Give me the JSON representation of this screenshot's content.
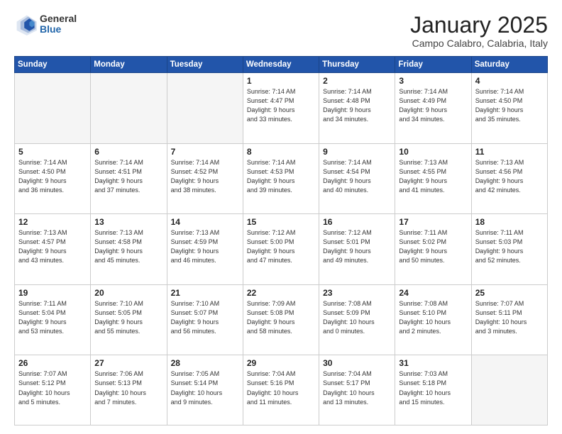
{
  "logo": {
    "general": "General",
    "blue": "Blue"
  },
  "header": {
    "month": "January 2025",
    "location": "Campo Calabro, Calabria, Italy"
  },
  "weekdays": [
    "Sunday",
    "Monday",
    "Tuesday",
    "Wednesday",
    "Thursday",
    "Friday",
    "Saturday"
  ],
  "weeks": [
    [
      {
        "day": "",
        "info": ""
      },
      {
        "day": "",
        "info": ""
      },
      {
        "day": "",
        "info": ""
      },
      {
        "day": "1",
        "info": "Sunrise: 7:14 AM\nSunset: 4:47 PM\nDaylight: 9 hours\nand 33 minutes."
      },
      {
        "day": "2",
        "info": "Sunrise: 7:14 AM\nSunset: 4:48 PM\nDaylight: 9 hours\nand 34 minutes."
      },
      {
        "day": "3",
        "info": "Sunrise: 7:14 AM\nSunset: 4:49 PM\nDaylight: 9 hours\nand 34 minutes."
      },
      {
        "day": "4",
        "info": "Sunrise: 7:14 AM\nSunset: 4:50 PM\nDaylight: 9 hours\nand 35 minutes."
      }
    ],
    [
      {
        "day": "5",
        "info": "Sunrise: 7:14 AM\nSunset: 4:50 PM\nDaylight: 9 hours\nand 36 minutes."
      },
      {
        "day": "6",
        "info": "Sunrise: 7:14 AM\nSunset: 4:51 PM\nDaylight: 9 hours\nand 37 minutes."
      },
      {
        "day": "7",
        "info": "Sunrise: 7:14 AM\nSunset: 4:52 PM\nDaylight: 9 hours\nand 38 minutes."
      },
      {
        "day": "8",
        "info": "Sunrise: 7:14 AM\nSunset: 4:53 PM\nDaylight: 9 hours\nand 39 minutes."
      },
      {
        "day": "9",
        "info": "Sunrise: 7:14 AM\nSunset: 4:54 PM\nDaylight: 9 hours\nand 40 minutes."
      },
      {
        "day": "10",
        "info": "Sunrise: 7:13 AM\nSunset: 4:55 PM\nDaylight: 9 hours\nand 41 minutes."
      },
      {
        "day": "11",
        "info": "Sunrise: 7:13 AM\nSunset: 4:56 PM\nDaylight: 9 hours\nand 42 minutes."
      }
    ],
    [
      {
        "day": "12",
        "info": "Sunrise: 7:13 AM\nSunset: 4:57 PM\nDaylight: 9 hours\nand 43 minutes."
      },
      {
        "day": "13",
        "info": "Sunrise: 7:13 AM\nSunset: 4:58 PM\nDaylight: 9 hours\nand 45 minutes."
      },
      {
        "day": "14",
        "info": "Sunrise: 7:13 AM\nSunset: 4:59 PM\nDaylight: 9 hours\nand 46 minutes."
      },
      {
        "day": "15",
        "info": "Sunrise: 7:12 AM\nSunset: 5:00 PM\nDaylight: 9 hours\nand 47 minutes."
      },
      {
        "day": "16",
        "info": "Sunrise: 7:12 AM\nSunset: 5:01 PM\nDaylight: 9 hours\nand 49 minutes."
      },
      {
        "day": "17",
        "info": "Sunrise: 7:11 AM\nSunset: 5:02 PM\nDaylight: 9 hours\nand 50 minutes."
      },
      {
        "day": "18",
        "info": "Sunrise: 7:11 AM\nSunset: 5:03 PM\nDaylight: 9 hours\nand 52 minutes."
      }
    ],
    [
      {
        "day": "19",
        "info": "Sunrise: 7:11 AM\nSunset: 5:04 PM\nDaylight: 9 hours\nand 53 minutes."
      },
      {
        "day": "20",
        "info": "Sunrise: 7:10 AM\nSunset: 5:05 PM\nDaylight: 9 hours\nand 55 minutes."
      },
      {
        "day": "21",
        "info": "Sunrise: 7:10 AM\nSunset: 5:07 PM\nDaylight: 9 hours\nand 56 minutes."
      },
      {
        "day": "22",
        "info": "Sunrise: 7:09 AM\nSunset: 5:08 PM\nDaylight: 9 hours\nand 58 minutes."
      },
      {
        "day": "23",
        "info": "Sunrise: 7:08 AM\nSunset: 5:09 PM\nDaylight: 10 hours\nand 0 minutes."
      },
      {
        "day": "24",
        "info": "Sunrise: 7:08 AM\nSunset: 5:10 PM\nDaylight: 10 hours\nand 2 minutes."
      },
      {
        "day": "25",
        "info": "Sunrise: 7:07 AM\nSunset: 5:11 PM\nDaylight: 10 hours\nand 3 minutes."
      }
    ],
    [
      {
        "day": "26",
        "info": "Sunrise: 7:07 AM\nSunset: 5:12 PM\nDaylight: 10 hours\nand 5 minutes."
      },
      {
        "day": "27",
        "info": "Sunrise: 7:06 AM\nSunset: 5:13 PM\nDaylight: 10 hours\nand 7 minutes."
      },
      {
        "day": "28",
        "info": "Sunrise: 7:05 AM\nSunset: 5:14 PM\nDaylight: 10 hours\nand 9 minutes."
      },
      {
        "day": "29",
        "info": "Sunrise: 7:04 AM\nSunset: 5:16 PM\nDaylight: 10 hours\nand 11 minutes."
      },
      {
        "day": "30",
        "info": "Sunrise: 7:04 AM\nSunset: 5:17 PM\nDaylight: 10 hours\nand 13 minutes."
      },
      {
        "day": "31",
        "info": "Sunrise: 7:03 AM\nSunset: 5:18 PM\nDaylight: 10 hours\nand 15 minutes."
      },
      {
        "day": "",
        "info": ""
      }
    ]
  ]
}
